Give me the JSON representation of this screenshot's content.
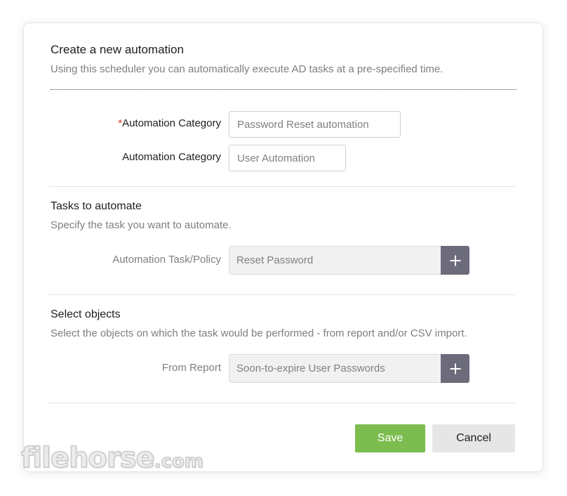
{
  "header": {
    "title": "Create a new automation",
    "subtitle": "Using this scheduler you can automatically execute AD tasks at a pre-specified time."
  },
  "fields": {
    "automation_category_1": {
      "required_marker": "*",
      "label": "Automation Category",
      "value": "Password Reset automation"
    },
    "automation_category_2": {
      "label": "Automation Category",
      "value": "User Automation"
    }
  },
  "tasks_section": {
    "title": "Tasks to automate",
    "description": "Specify the task you want to automate.",
    "field_label": "Automation Task/Policy",
    "field_value": "Reset Password",
    "add_icon": "plus-icon"
  },
  "objects_section": {
    "title": "Select objects",
    "description": "Select the objects on which the task would be performed - from report and/or CSV import.",
    "field_label": "From Report",
    "field_value": "Soon-to-expire User Passwords",
    "add_icon": "plus-icon"
  },
  "actions": {
    "save_label": "Save",
    "cancel_label": "Cancel"
  },
  "watermark": {
    "brand": "filehorse",
    "suffix": ".com"
  },
  "colors": {
    "save_button": "#7dbd4f",
    "cancel_button": "#e6e6e6",
    "add_button": "#6b6b7b",
    "required": "#e03030"
  }
}
